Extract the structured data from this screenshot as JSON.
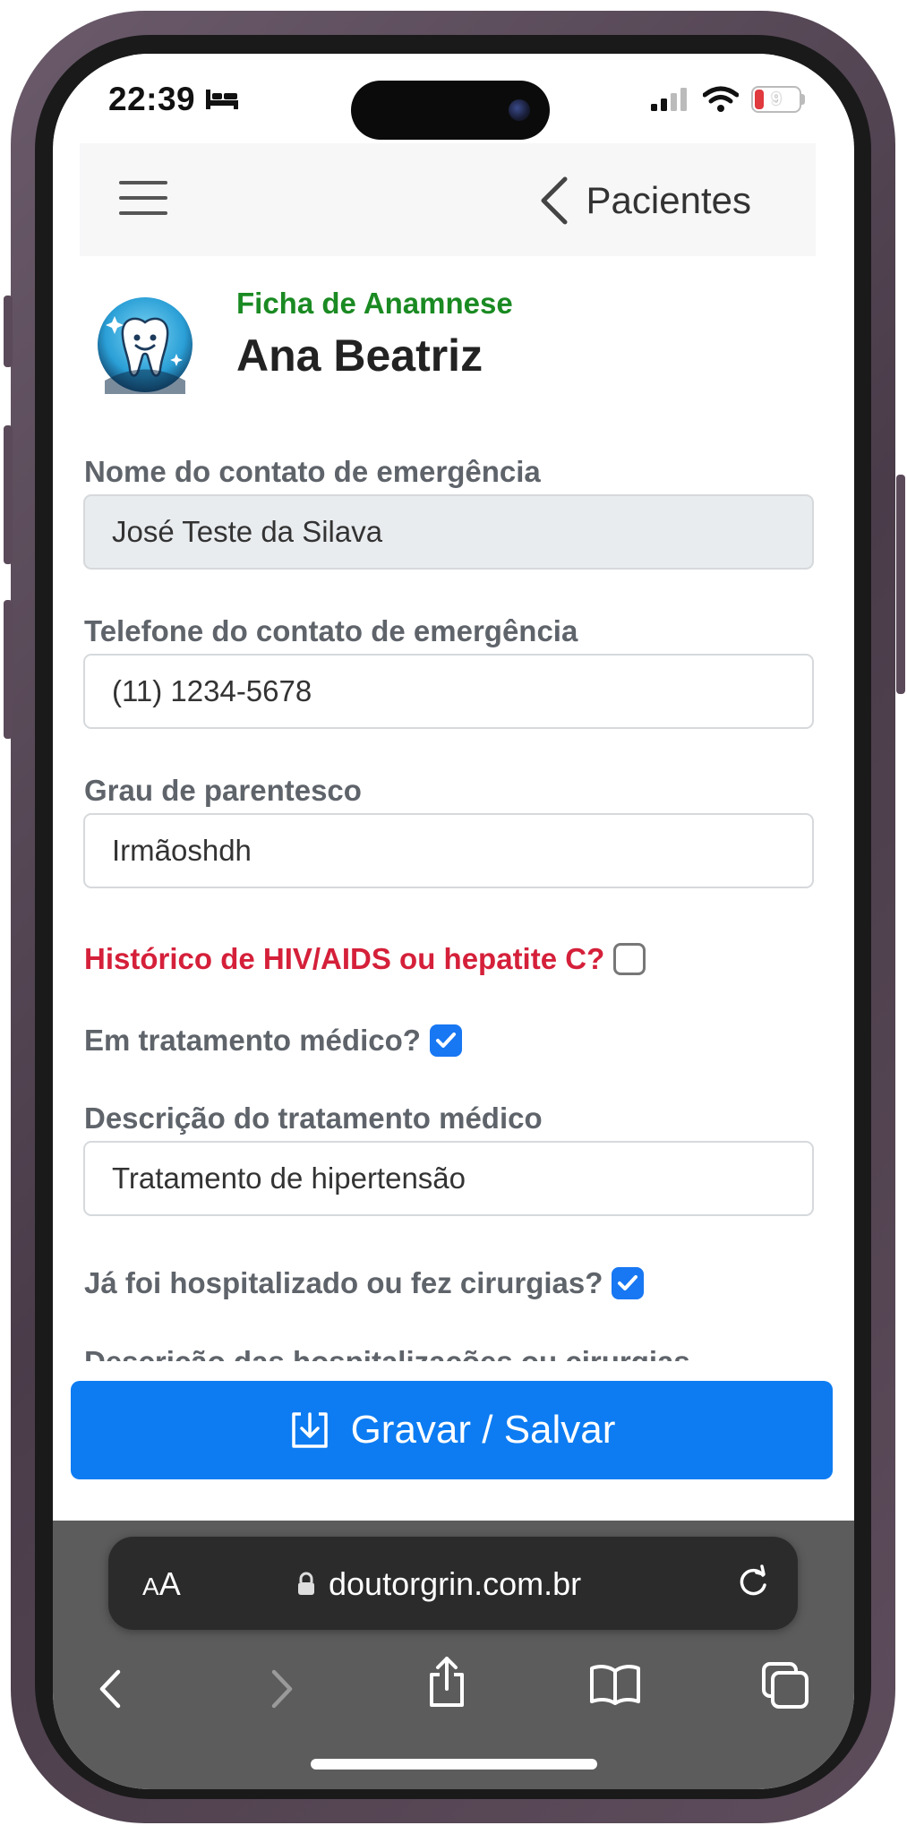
{
  "status_bar": {
    "time": "22:39",
    "battery_level": "9",
    "battery_color": "#e0393e",
    "icons": [
      "bed-icon",
      "signal-icon",
      "wifi-icon",
      "battery-icon"
    ]
  },
  "nav": {
    "back_label": "Pacientes",
    "icons": [
      "menu-icon",
      "chevron-left-icon"
    ]
  },
  "header": {
    "subtitle": "Ficha de Anamnese",
    "patient_name": "Ana Beatriz",
    "subtitle_color": "#1a8a22",
    "logo_icon": "tooth-mascot-icon"
  },
  "form": {
    "emergency_contact_name": {
      "label": "Nome do contato de emergência",
      "value": "José Teste da Silava",
      "readonly": true
    },
    "emergency_contact_phone": {
      "label": "Telefone do contato de emergência",
      "value": "(11) 1234-5678"
    },
    "relationship": {
      "label": "Grau de parentesco",
      "value": "Irmãoshdh"
    },
    "hiv_history": {
      "label": "Histórico de HIV/AIDS ou hepatite C?",
      "checked": false,
      "label_color": "#d5203a"
    },
    "medical_treatment": {
      "label": "Em tratamento médico?",
      "checked": true
    },
    "treatment_description": {
      "label": "Descrição do tratamento médico",
      "value": "Tratamento de hipertensão"
    },
    "hospitalized": {
      "label": "Já foi hospitalizado ou fez cirurgias?",
      "checked": true
    },
    "hospitalization_description": {
      "label": "Descrição das hospitalizações ou cirurgias"
    }
  },
  "save_button": {
    "label": "Gravar / Salvar",
    "color": "#0d7cf2",
    "icon": "save-download-icon"
  },
  "browser": {
    "text_size_small": "A",
    "text_size_big": "A",
    "url": "doutorgrin.com.br",
    "icons": [
      "lock-icon",
      "reload-icon",
      "back-icon",
      "forward-icon",
      "share-icon",
      "bookmarks-icon",
      "tabs-icon"
    ]
  }
}
